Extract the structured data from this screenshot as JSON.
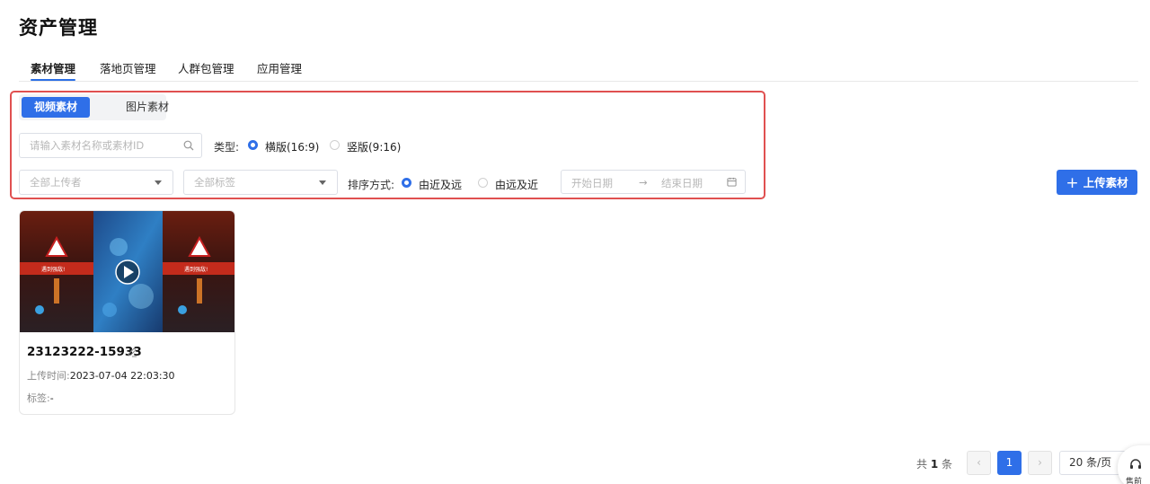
{
  "page": {
    "title": "资产管理"
  },
  "tabs": [
    {
      "label": "素材管理",
      "active": true
    },
    {
      "label": "落地页管理",
      "active": false
    },
    {
      "label": "人群包管理",
      "active": false
    },
    {
      "label": "应用管理",
      "active": false
    }
  ],
  "material_type": {
    "options": [
      "视频素材",
      "图片素材"
    ],
    "selected": "视频素材"
  },
  "filters": {
    "search_placeholder": "请输入素材名称或素材ID",
    "type_label": "类型:",
    "type_options": [
      "横版(16:9)",
      "竖版(9:16)"
    ],
    "type_selected": "横版(16:9)",
    "uploader_placeholder": "全部上传者",
    "tag_placeholder": "全部标签",
    "sort_label": "排序方式:",
    "sort_options": [
      "由近及远",
      "由远及近"
    ],
    "sort_selected": "由近及远",
    "date_start_placeholder": "开始日期",
    "date_separator": "→",
    "date_end_placeholder": "结束日期"
  },
  "toolbar": {
    "upload_label": "上传素材"
  },
  "cards": [
    {
      "title": "23123222-15933",
      "upload_time_label": "上传时间:",
      "upload_time": "2023-07-04 22:03:30",
      "tag_label": "标签:",
      "tag_value": "-",
      "thumb_banner_text": "遇到强敌!"
    }
  ],
  "pagination": {
    "total_prefix": "共",
    "total": "1",
    "total_suffix": "条",
    "prev": "‹",
    "current_page": "1",
    "next": "›",
    "page_size": "20 条/页"
  },
  "float_help": {
    "label": "售前"
  },
  "colors": {
    "primary": "#2f6fe8",
    "highlight_border": "#e05050"
  }
}
